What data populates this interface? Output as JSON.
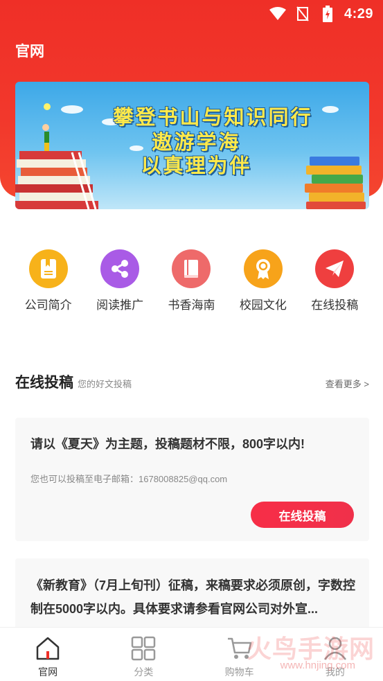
{
  "status_bar": {
    "time": "4:29"
  },
  "header": {
    "title": "官网"
  },
  "banner": {
    "line1": "攀登书山与知识同行",
    "line2": "遨游学海",
    "line3": "以真理为伴"
  },
  "quick_menu": [
    {
      "label": "公司简介",
      "icon": "bookmark-icon",
      "color": "#f7b21a"
    },
    {
      "label": "阅读推广",
      "icon": "share-icon",
      "color": "#a95be6"
    },
    {
      "label": "书香海南",
      "icon": "book-icon",
      "color": "#ee6a6a"
    },
    {
      "label": "校园文化",
      "icon": "medal-icon",
      "color": "#f7a31a"
    },
    {
      "label": "在线投稿",
      "icon": "paper-plane-icon",
      "color": "#ef3f3f"
    }
  ],
  "section": {
    "title": "在线投稿",
    "subtitle": "您的好文投稿",
    "more": "查看更多 >"
  },
  "cards": [
    {
      "title": "请以《夏天》为主题，投稿题材不限，800字以内!",
      "desc": "您也可以投稿至电子邮箱：1678008825@qq.com",
      "button": "在线投稿"
    },
    {
      "text": "《新教育》（7月上旬刊）征稿，来稿要求必须原创，字数控制在5000字以内。具体要求请参看官网公司对外宣..."
    }
  ],
  "tab_bar": [
    {
      "label": "官网",
      "icon": "home-icon",
      "active": true
    },
    {
      "label": "分类",
      "icon": "grid-icon",
      "active": false
    },
    {
      "label": "购物车",
      "icon": "cart-icon",
      "active": false
    },
    {
      "label": "我的",
      "icon": "user-icon",
      "active": false
    }
  ],
  "watermark": {
    "text": "火鸟手游网",
    "url": "www.hnjing.com"
  },
  "colors": {
    "brand_red": "#ef2f27",
    "button_red": "#f72e47"
  }
}
